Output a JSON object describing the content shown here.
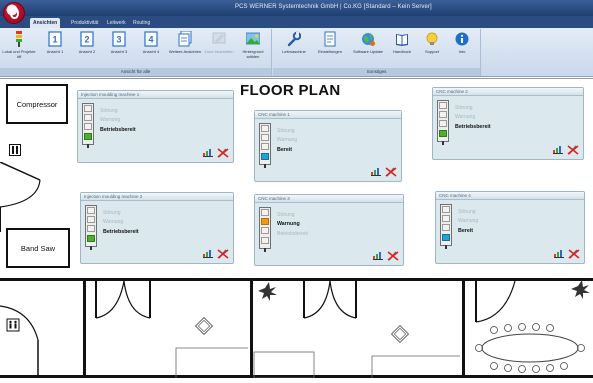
{
  "window": {
    "title": "PCS WERNER Systemtechnik GmbH | Co.KG [Standard – Kein Server]"
  },
  "tabs": [
    {
      "label": "Ansichten",
      "active": true
    },
    {
      "label": "Produktivität",
      "active": false
    },
    {
      "label": "Leitwerk",
      "active": false
    },
    {
      "label": "Routing",
      "active": false
    }
  ],
  "ribbon": {
    "groups": [
      {
        "label": "Ansicht für alle"
      },
      {
        "label": "Sonstiges"
      }
    ],
    "buttons": [
      {
        "label": "Lokal und Projekte öff",
        "icon": "status-light-icon",
        "disabled": false
      },
      {
        "label": "Ansicht 1",
        "icon": "page-1-icon",
        "disabled": false
      },
      {
        "label": "Ansicht 2",
        "icon": "page-2-icon",
        "disabled": false
      },
      {
        "label": "Ansicht 3",
        "icon": "page-3-icon",
        "disabled": false
      },
      {
        "label": "Ansicht 4",
        "icon": "page-4-icon",
        "disabled": false
      },
      {
        "label": "Weitere Ansichten",
        "icon": "pages-stack-icon",
        "disabled": false
      },
      {
        "label": "Zone bearbeiten",
        "icon": "zone-edit-icon",
        "disabled": true
      },
      {
        "label": "Hintergrund wählen",
        "icon": "background-image-icon",
        "disabled": false
      },
      {
        "label": "Leitmaschine",
        "icon": "wrench-icon",
        "disabled": false
      },
      {
        "label": "Einstellungen",
        "icon": "document-settings-icon",
        "disabled": false
      },
      {
        "label": "Software Update",
        "icon": "globe-update-icon",
        "disabled": false
      },
      {
        "label": "Handbuch",
        "icon": "book-icon",
        "disabled": false
      },
      {
        "label": "Support",
        "icon": "support-bulb-icon",
        "disabled": false
      },
      {
        "label": "Info",
        "icon": "info-icon",
        "disabled": false
      }
    ]
  },
  "floor": {
    "title": "FLOOR PLAN",
    "rooms": {
      "compressor": "Compressor",
      "band_saw": "Band Saw"
    }
  },
  "machines": [
    {
      "name": "Injection moulding machine 1",
      "lines": [
        "Störung",
        "Warnung",
        "Betriebsbereit"
      ],
      "active_index": 2,
      "lamp": "green"
    },
    {
      "name": "CNC machine 1",
      "lines": [
        "Störung",
        "Warnung",
        "Bereit"
      ],
      "active_index": 2,
      "lamp": "blue"
    },
    {
      "name": "CNC machine 2",
      "lines": [
        "Störung",
        "Warnung",
        "Betriebsbereit"
      ],
      "active_index": 2,
      "lamp": "green"
    },
    {
      "name": "Injection moulding machine 2",
      "lines": [
        "Störung",
        "Warnung",
        "Betriebsbereit"
      ],
      "active_index": 2,
      "lamp": "green"
    },
    {
      "name": "CNC machine 3",
      "lines": [
        "Störung",
        "Warnung",
        "Betriebsbereit"
      ],
      "active_index": 1,
      "lamp": "orange"
    },
    {
      "name": "CNC machine 4",
      "lines": [
        "Störung",
        "Warnung",
        "Bereit"
      ],
      "active_index": 2,
      "lamp": "blue"
    }
  ],
  "colors": {
    "lamp_green": "#4caf2f",
    "lamp_orange": "#f29a16",
    "lamp_blue": "#1ea3dc",
    "ribbon_bg": "#dbe6f2",
    "titlebar_bg": "#2a4c80"
  }
}
